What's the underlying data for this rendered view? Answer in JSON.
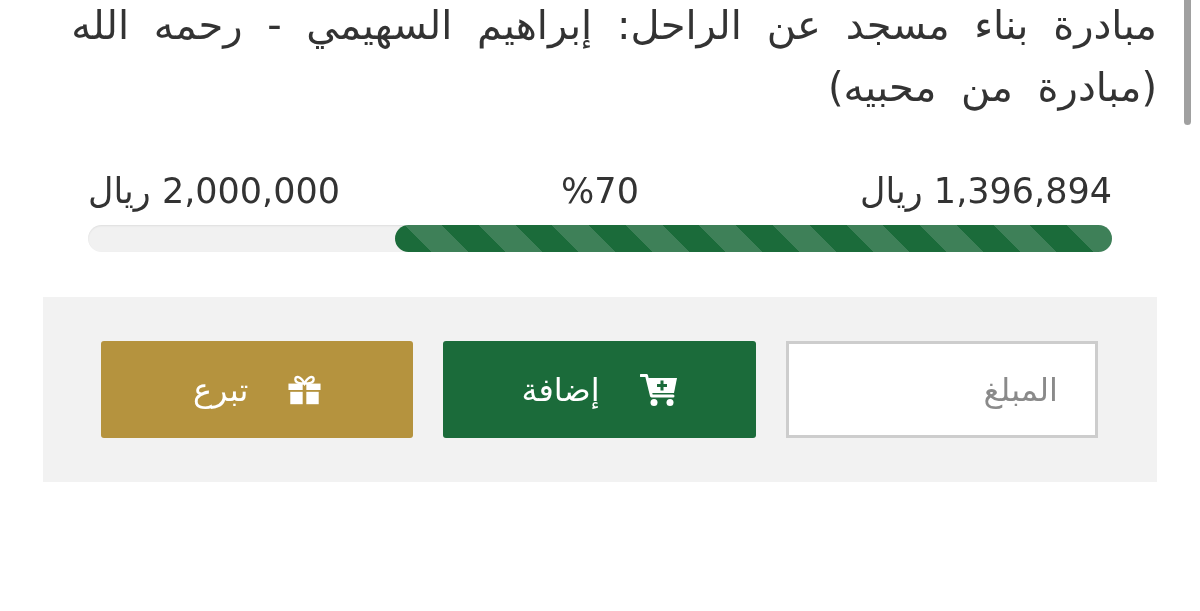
{
  "title": "مبادرة بناء مسجد عن الراحل: إبراهيم السهيمي - رحمه الله (مبادرة من محبيه)",
  "progress": {
    "raised": "1,396,894 ريال",
    "percent": "%70",
    "goal": "2,000,000 ريال",
    "level": 0.7
  },
  "donation_form": {
    "amount_field": {
      "placeholder": "المبلغ"
    },
    "buttons": [
      {
        "kind": "add",
        "label": "إضافة"
      },
      {
        "kind": "donate",
        "label": "تبرع"
      }
    ]
  }
}
